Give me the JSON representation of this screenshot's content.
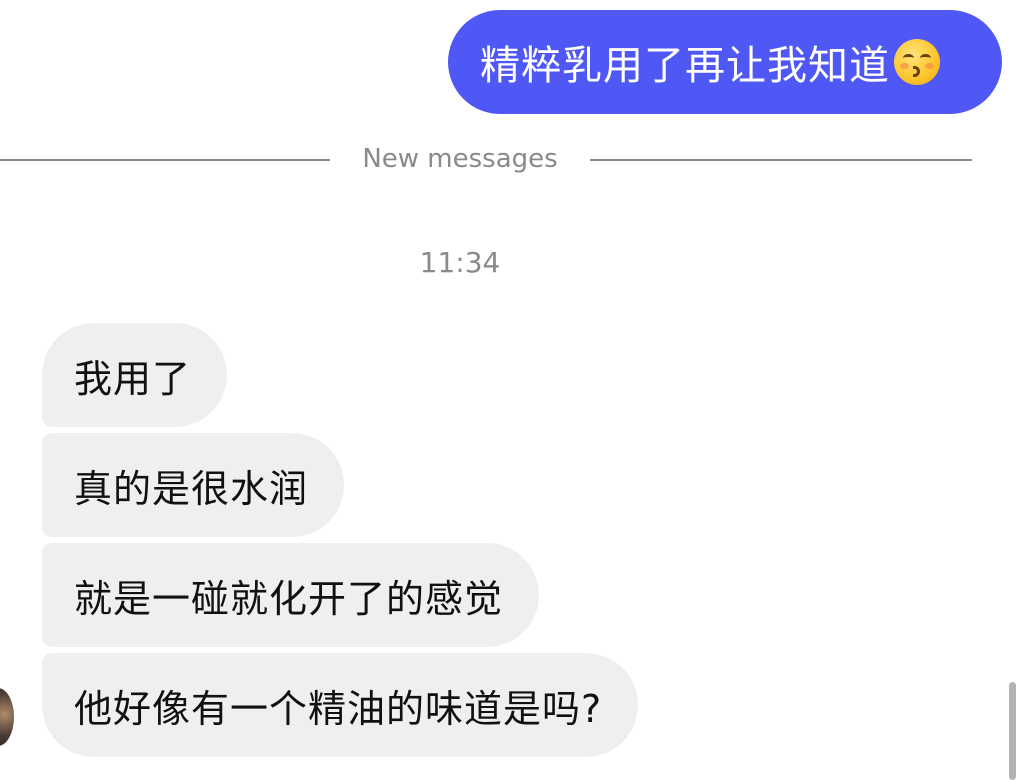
{
  "messages": {
    "outgoing": [
      {
        "text": "精粹乳用了再让我知道",
        "emoji": "kissing-face-with-closed-eyes"
      }
    ],
    "divider_label": "New messages",
    "timestamp": "11:34",
    "incoming": [
      {
        "text": "我用了"
      },
      {
        "text": "真的是很水润"
      },
      {
        "text": "就是一碰就化开了的感觉"
      },
      {
        "text": "他好像有一个精油的味道是吗?"
      }
    ]
  },
  "colors": {
    "outgoing_bubble": "#4f57f5",
    "incoming_bubble": "#efefef",
    "meta_text": "#8a8a8e"
  }
}
